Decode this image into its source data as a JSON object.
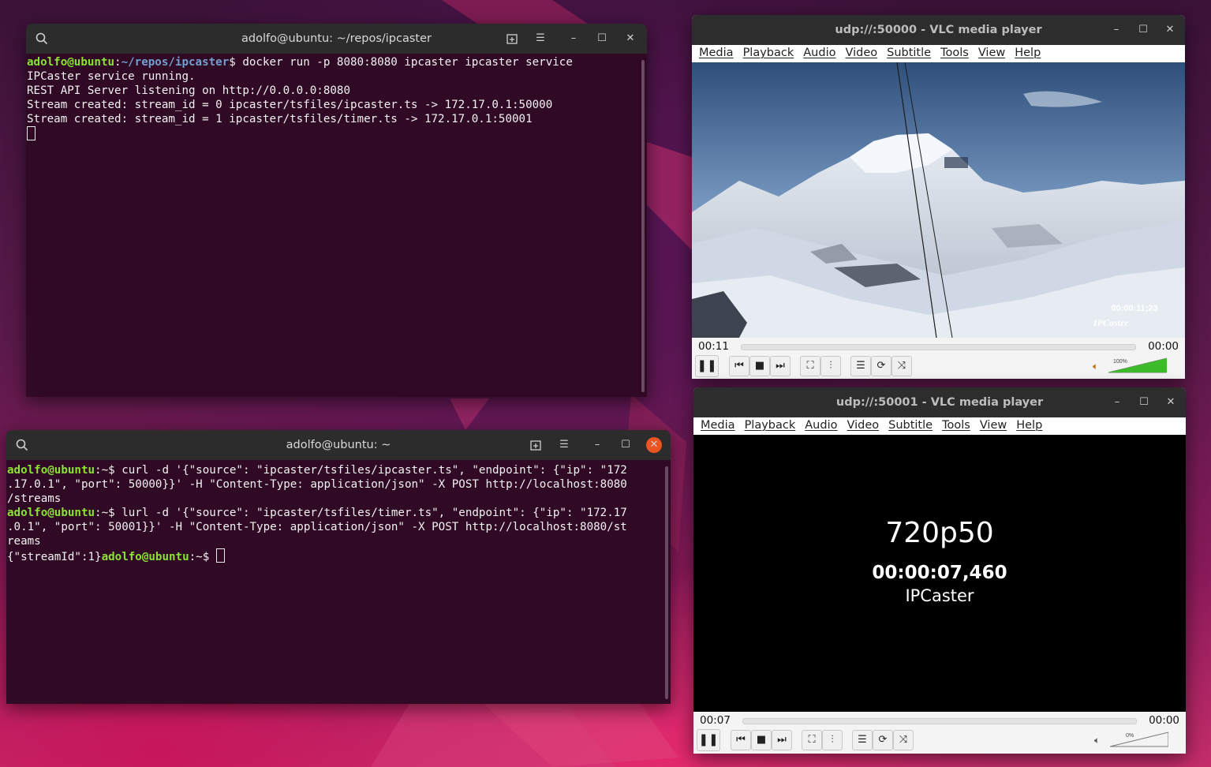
{
  "terminal1": {
    "title": "adolfo@ubuntu: ~/repos/ipcaster",
    "prompt_user": "adolfo@ubuntu",
    "prompt_path": "~/repos/ipcaster",
    "command": "$ docker run -p 8080:8080 ipcaster ipcaster service",
    "output": [
      "IPCaster service running.",
      "REST API Server listening on http://0.0.0.0:8080",
      "Stream created: stream_id = 0 ipcaster/tsfiles/ipcaster.ts -> 172.17.0.1:50000",
      "Stream created: stream_id = 1 ipcaster/tsfiles/timer.ts -> 172.17.0.1:50001"
    ]
  },
  "terminal2": {
    "title": "adolfo@ubuntu: ~",
    "prompt_user": "adolfo@ubuntu",
    "prompt_path": ":~",
    "cmd1": {
      "line1": "$ curl -d '{\"source\": \"ipcaster/tsfiles/ipcaster.ts\", \"endpoint\": {\"ip\": \"172",
      "line2": ".17.0.1\", \"port\": 50000}}' -H \"Content-Type: application/json\" -X POST http://localhost:8080",
      "line3": "/streams"
    },
    "cmd2": {
      "line1": "$ lurl -d '{\"source\": \"ipcaster/tsfiles/timer.ts\", \"endpoint\": {\"ip\": \"172.17",
      "line2": ".0.1\", \"port\": 50001}}' -H \"Content-Type: application/json\" -X POST http://localhost:8080/st",
      "line3": "reams"
    },
    "response": "{\"streamId\":1}",
    "final_prompt_tail": ":~$ "
  },
  "vlc1": {
    "title": "udp://:50000 - VLC media player",
    "menu": [
      "Media",
      "Playback",
      "Audio",
      "Video",
      "Subtitle",
      "Tools",
      "View",
      "Help"
    ],
    "overlay_timecode": "00:00:11;23",
    "overlay_brand": "IPCaster",
    "time_elapsed": "00:11",
    "time_total": "00:00",
    "volume_label": "100%",
    "volume_level": 1.0
  },
  "vlc2": {
    "title": "udp://:50001 - VLC media player",
    "menu": [
      "Media",
      "Playback",
      "Audio",
      "Video",
      "Subtitle",
      "Tools",
      "View",
      "Help"
    ],
    "video_format": "720p50",
    "video_timer": "00:00:07,460",
    "video_brand": "IPCaster",
    "time_elapsed": "00:07",
    "time_total": "00:00",
    "volume_label": "0%",
    "volume_level": 0.0
  },
  "colors": {
    "terminal_bg": "#300a24",
    "prompt_user": "#8ae234",
    "prompt_path": "#729fcf",
    "ubuntu_orange": "#e95420",
    "volume_green": "#3dbb2a"
  },
  "icons": {
    "search": "search-icon",
    "new_tab": "new-tab-icon",
    "hamburger": "menu-icon",
    "minimize": "minimize-icon",
    "maximize": "maximize-icon",
    "close": "close-icon",
    "pause": "pause-icon",
    "prev": "previous-icon",
    "stop": "stop-icon",
    "next": "next-icon",
    "fullscreen": "fullscreen-icon",
    "settings": "extended-settings-icon",
    "playlist": "playlist-icon",
    "loop": "loop-icon",
    "shuffle": "shuffle-icon",
    "speaker": "speaker-icon"
  }
}
